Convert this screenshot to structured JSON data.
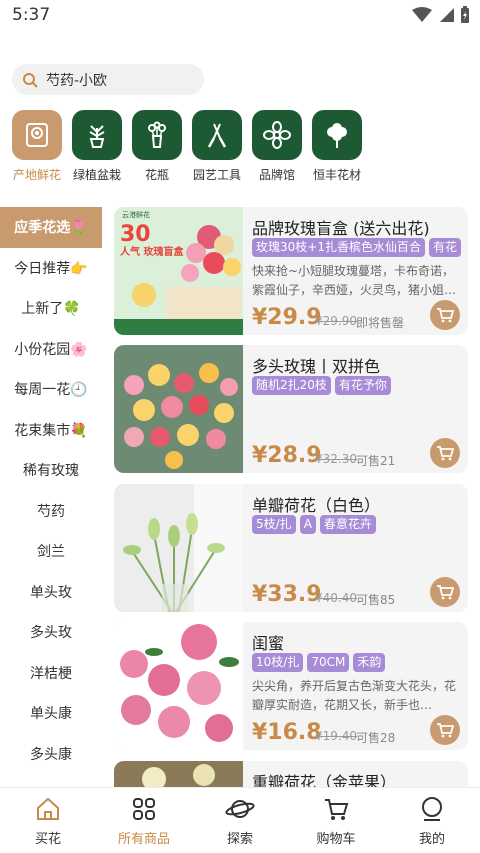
{
  "status_bar": {
    "time": "5:37",
    "icons": [
      "wifi-icon",
      "signal-icon",
      "battery-icon"
    ]
  },
  "search": {
    "value": "芍药-小欧"
  },
  "categories": [
    {
      "label": "产地鲜花",
      "icon": "camera-frame-icon",
      "active": true
    },
    {
      "label": "绿植盆栽",
      "icon": "potted-plant-icon"
    },
    {
      "label": "花瓶",
      "icon": "vase-icon"
    },
    {
      "label": "园艺工具",
      "icon": "garden-scissors-icon"
    },
    {
      "label": "品牌馆",
      "icon": "flower-icon"
    },
    {
      "label": "恒丰花材",
      "icon": "cotton-icon"
    }
  ],
  "sidebar": {
    "items": [
      {
        "label": "应季花选🌷",
        "active": true
      },
      {
        "label": "今日推荐👉"
      },
      {
        "label": "上新了🍀"
      },
      {
        "label": "小份花园🌸"
      },
      {
        "label": "每周一花🕘"
      },
      {
        "label": "花束集市💐"
      },
      {
        "label": "稀有玫瑰"
      },
      {
        "label": "芍药"
      },
      {
        "label": "剑兰"
      },
      {
        "label": "单头玫"
      },
      {
        "label": "多头玫"
      },
      {
        "label": "洋桔梗"
      },
      {
        "label": "单头康"
      },
      {
        "label": "多头康"
      }
    ]
  },
  "products": [
    {
      "title": "品牌玫瑰盲盒 (送六出花)",
      "tags": [
        "玫瑰30枝+1扎香槟色水仙百合",
        "有花"
      ],
      "desc": "快来抢~小短腿玫瑰蔓塔，卡布奇诺，紫霞仙子，辛西娅，火灵鸟，猪小姐…",
      "price": "¥29.9",
      "orig": "¥29.90",
      "sold": "即将售罄",
      "thumb": {
        "top_text": "云港鲜花",
        "headline": "30",
        "sub": "人气 玫瑰盲盒",
        "bg": "#d9ecd3",
        "accent": "#e8453c"
      }
    },
    {
      "title": "多头玫瑰丨双拼色",
      "tags": [
        "随机2扎20枝",
        "有花予你"
      ],
      "desc": "",
      "price": "¥28.9",
      "orig": "¥32.30",
      "sold": "可售21",
      "thumb": {
        "bg": "#6d8a72"
      }
    },
    {
      "title": "单瓣荷花（白色）",
      "tags": [
        "5枝/扎",
        "A",
        "春意花卉"
      ],
      "desc": "",
      "price": "¥33.9",
      "orig": "¥40.40",
      "sold": "可售85",
      "thumb": {
        "bg": "#ececec"
      }
    },
    {
      "title": "闺蜜",
      "tags": [
        "10枝/扎",
        "70CM",
        "禾韵"
      ],
      "desc": "尖尖角，养开后复古色渐变大花头，花瓣厚实耐造，花期又长，新手也…",
      "price": "¥16.8",
      "orig": "¥19.40",
      "sold": "可售28",
      "thumb": {
        "bg": "#ffffff"
      }
    },
    {
      "title": "重瓣荷花（金苹果）",
      "tags": [],
      "desc": "",
      "price": "",
      "orig": "",
      "sold": "",
      "thumb": {
        "bg": "#e9e6d8"
      }
    }
  ],
  "tabbar": [
    {
      "label": "买花",
      "icon": "home-icon"
    },
    {
      "label": "所有商品",
      "icon": "grid-icon",
      "active": true
    },
    {
      "label": "探索",
      "icon": "planet-icon"
    },
    {
      "label": "购物车",
      "icon": "cart-icon"
    },
    {
      "label": "我的",
      "icon": "user-icon"
    }
  ],
  "colors": {
    "accent": "#c99a6e",
    "accent_text": "#c98a47",
    "category_bg": "#1d5a34",
    "tag": "#a78bd6"
  }
}
